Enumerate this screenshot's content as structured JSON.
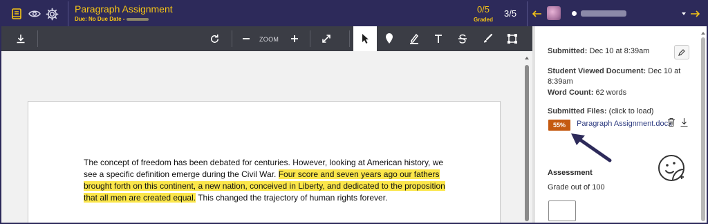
{
  "header": {
    "assignment_title": "Paragraph Assignment",
    "due_label": "Due: No Due Date -",
    "graded_count": "0/5",
    "graded_label": "Graded",
    "student_index": "3/5",
    "icons": [
      "gradebook-icon",
      "eye-icon",
      "gear-icon",
      "arrow-left-icon",
      "arrow-right-icon",
      "chevron-down-icon"
    ]
  },
  "toolbar": {
    "zoom_label": "ZOOM",
    "tools": [
      "download-icon",
      "rotate-icon",
      "zoom-out-icon",
      "zoom-in-icon",
      "fullscreen-icon",
      "pointer-tool-icon",
      "point-annotation-icon",
      "highlight-tool-icon",
      "text-tool-icon",
      "strikeout-tool-icon",
      "freehand-draw-icon",
      "area-select-icon"
    ],
    "active_tool": "pointer-tool-icon"
  },
  "document": {
    "text_before": "The concept of freedom has been debated for centuries. However, looking at American history, we see a specific definition emerge during the Civil War. ",
    "highlighted": "Four score and seven years ago our fathers brought forth on this continent, a new nation, conceived in Liberty, and dedicated to the proposition that all men are created equal.",
    "text_after": " This changed the trajectory of human rights forever.",
    "highlight_color": "#fbe64a"
  },
  "panel": {
    "submitted_label": "Submitted:",
    "submitted_value": "Dec 10 at 8:39am",
    "viewed_label": "Student Viewed Document:",
    "viewed_value_a": "Dec 10 at",
    "viewed_value_b": "8:39am",
    "word_count_label": "Word Count:",
    "word_count_value": "62 words",
    "files_label": "Submitted Files:",
    "files_hint": "(click to load)",
    "similarity_badge": "55%",
    "file_name": "Paragraph Assignment.docx",
    "assessment_heading": "Assessment",
    "grade_out_of": "Grade out of 100",
    "badge_color": "#c55a11",
    "accent_color": "#2d2a5a"
  }
}
